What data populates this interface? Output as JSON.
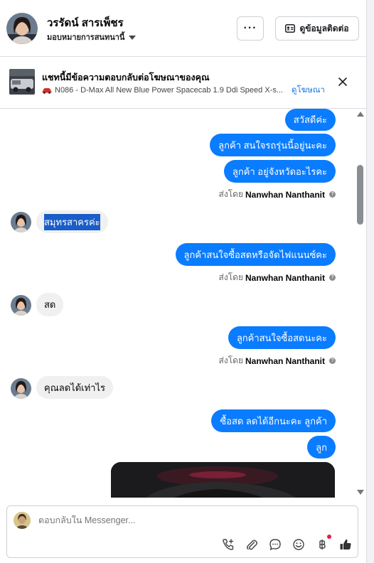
{
  "header": {
    "name": "วรรัดน์ สารเพ็ชร",
    "assign_label": "มอบหมายการสนทนานี้",
    "more_label": "···",
    "contact_label": "ดูข้อมูลติดต่อ"
  },
  "ad": {
    "title": "แชทนี้มีข้อความตอบกลับต่อโฆษณาของคุณ",
    "subtitle": "N086 - D-Max All New Blue Power Spacecab 1.9 Ddi Speed X-s...",
    "link": "ดูโฆษณา"
  },
  "messages": {
    "m1": "สวัสดีค่ะ",
    "m2": "ลูกค้า สนใจรถรุ่นนี้อยู่นะคะ",
    "m3": "ลูกค้า อยู่จังหวัดอะไรคะ",
    "m4": "สมุทรสาครค่ะ",
    "m5": "ลูกค้าสนใจซื้อสดหรือจัดไฟแนนซ์คะ",
    "m6": "สด",
    "m7": "ลูกค้าสนใจซื้อสดนะคะ",
    "m8": "คุณลดได้เท่าไร",
    "m9": "ซื้อสด ลดได้อีกนะคะ  ลูกค้า",
    "m10": "ลูก"
  },
  "sent_by": {
    "prefix": "ส่งโดย",
    "agent": "Nanwhan Nanthanit",
    "help_glyph": "?"
  },
  "composer": {
    "placeholder": "ตอบกลับใน Messenger..."
  },
  "icons": {
    "call": "phone-plus-icon",
    "attach": "paperclip-icon",
    "saved_reply": "chat-bubble-icon",
    "emoji": "smiley-icon",
    "payment": "baht-icon",
    "like": "thumbs-up-icon"
  },
  "colors": {
    "outgoing_bubble": "#0a7cff",
    "incoming_bubble": "#f0f0f0",
    "link": "#1b74e4"
  }
}
